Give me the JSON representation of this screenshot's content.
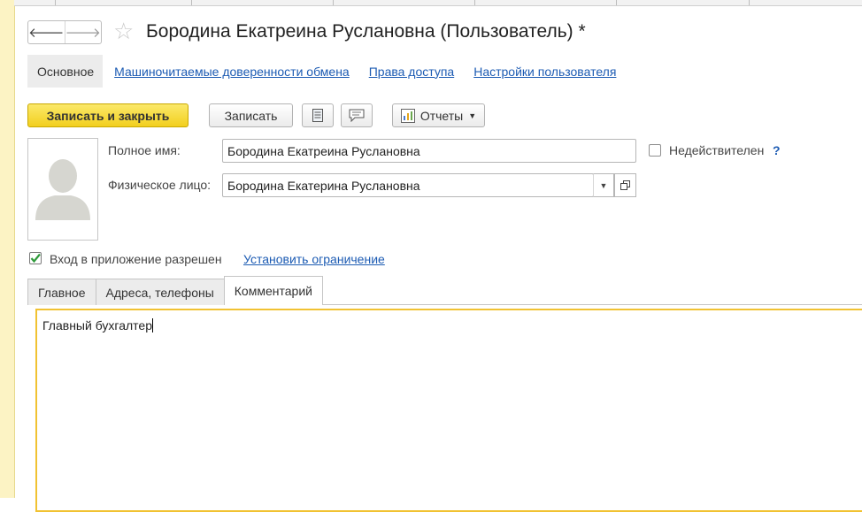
{
  "window": {
    "title": "Бородина Екатреина Руслановна (Пользователь) *"
  },
  "nav": {
    "back_icon": "arrow-left-icon",
    "forward_icon": "arrow-right-icon",
    "favorite_icon": "star-icon"
  },
  "tabs": [
    {
      "label": "Основное",
      "active": true
    },
    {
      "label": "Машиночитаемые доверенности обмена",
      "active": false
    },
    {
      "label": "Права доступа",
      "active": false
    },
    {
      "label": "Настройки пользователя",
      "active": false
    }
  ],
  "toolbar": {
    "save_close_label": "Записать и закрыть",
    "save_label": "Записать",
    "reports_label": "Отчеты",
    "document_icon": "document-icon",
    "comment_icon": "comment-icon",
    "reports_icon": "reports-icon"
  },
  "form": {
    "full_name_label": "Полное имя:",
    "full_name_value": "Бородина Екатреина Руслановна",
    "inactive_label": "Недействителен",
    "inactive_checked": false,
    "help_label": "?",
    "person_label": "Физическое лицо:",
    "person_value": "Бородина Екатерина Руслановна",
    "login_label": "Вход в приложение разрешен",
    "login_checked": true,
    "restriction_link": "Установить ограничение"
  },
  "page_tabs": [
    {
      "label": "Главное",
      "active": false
    },
    {
      "label": "Адреса, телефоны",
      "active": false
    },
    {
      "label": "Комментарий",
      "active": true
    }
  ],
  "comment": {
    "text": "Главный бухгалтер"
  },
  "colors": {
    "accent_yellow": "#f2cf1e",
    "link_blue": "#1c5bb3",
    "focus_border": "#f1c232"
  }
}
